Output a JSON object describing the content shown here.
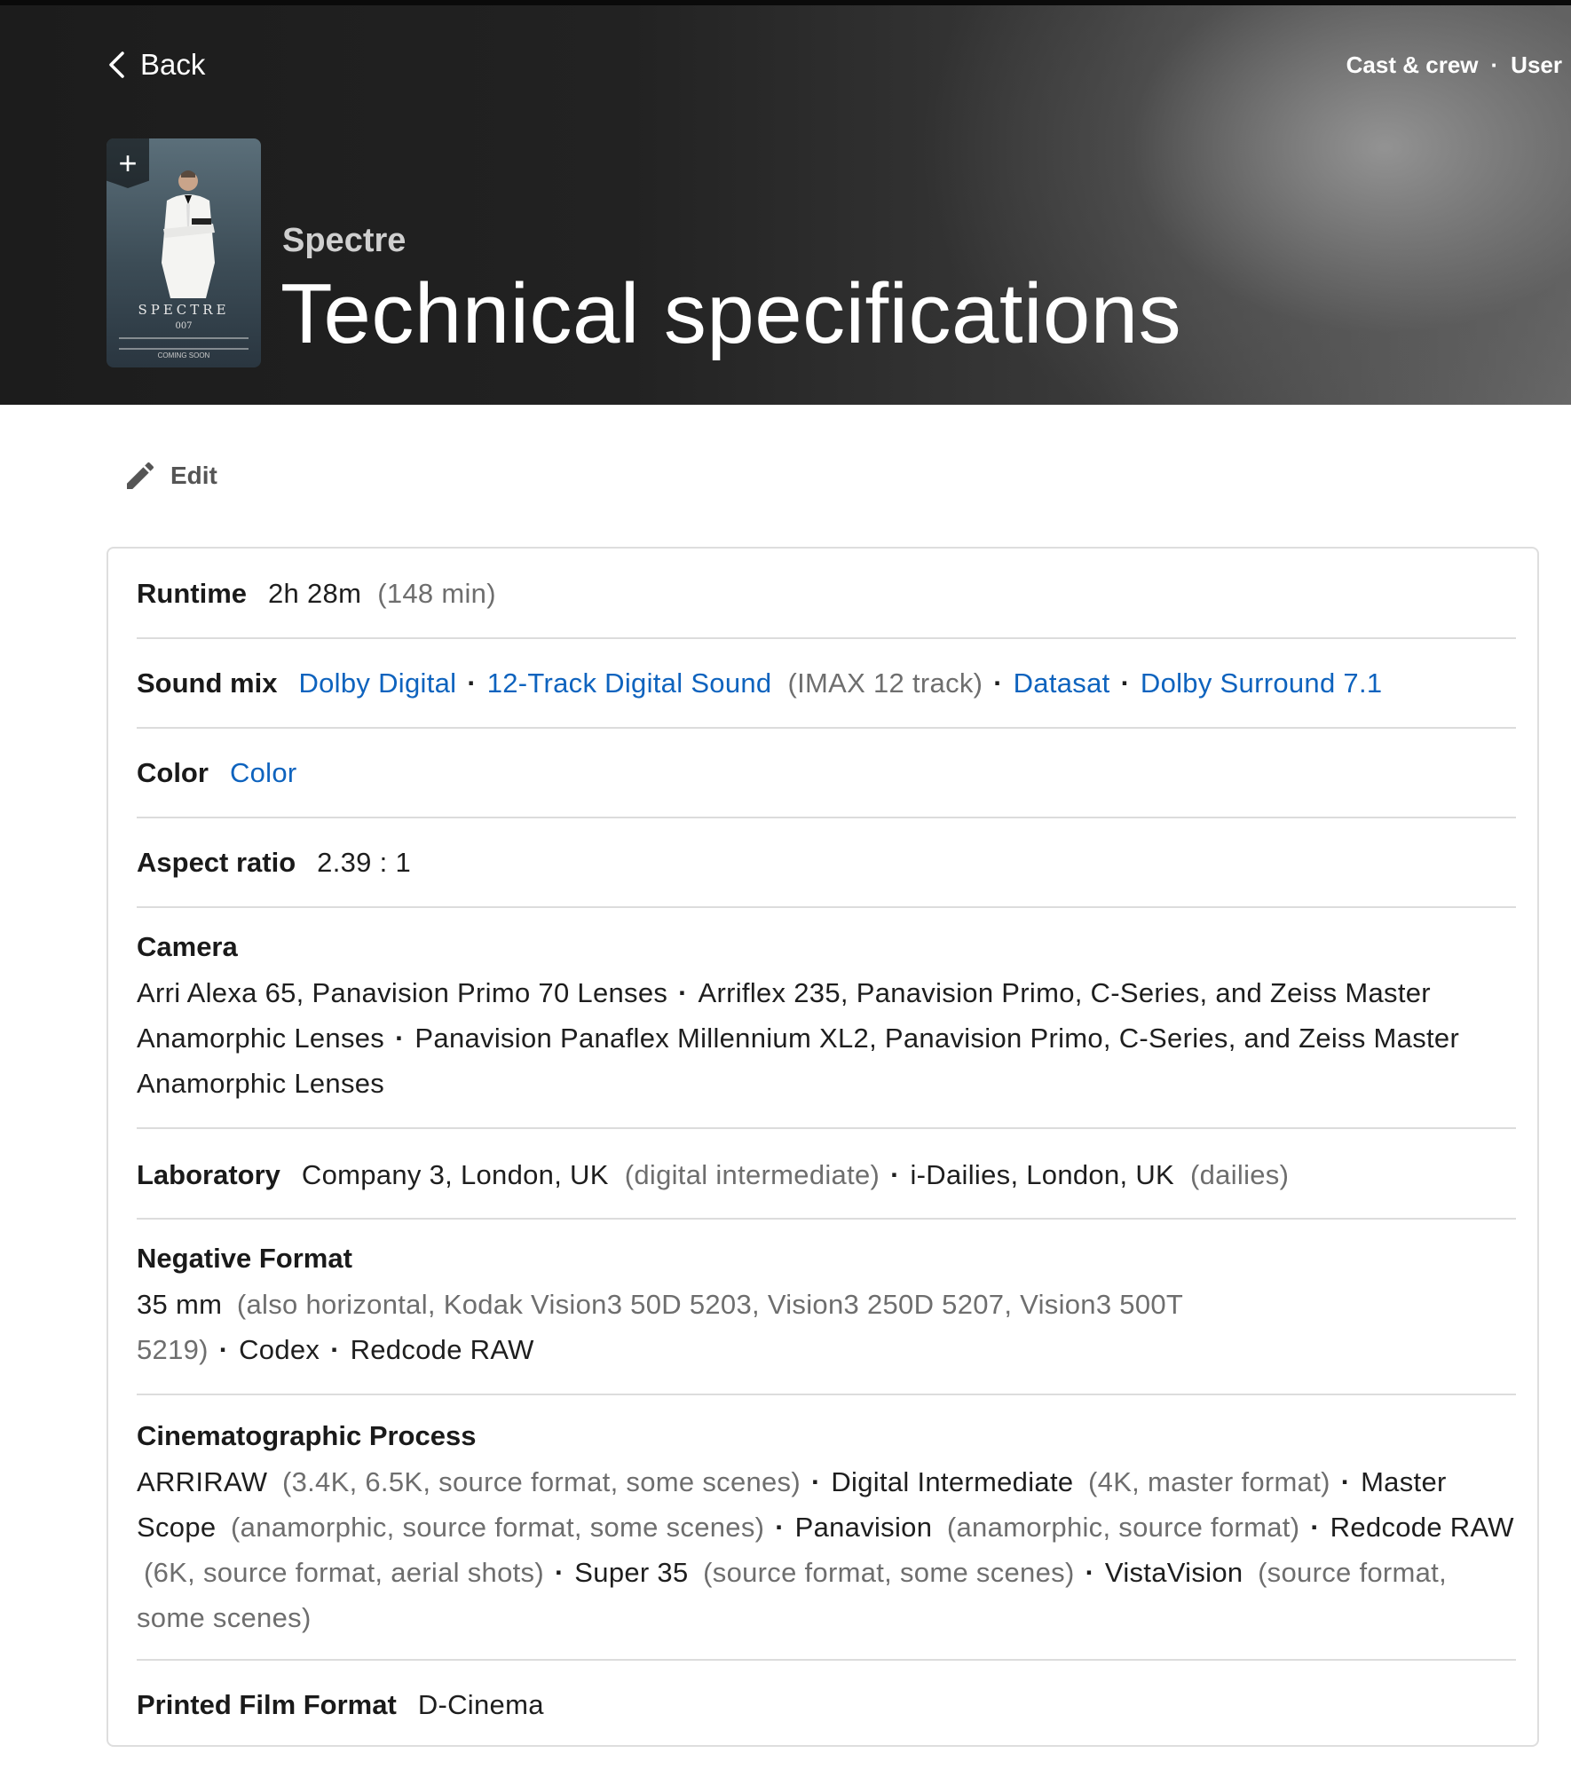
{
  "header": {
    "back_label": "Back",
    "nav": [
      "Cast & crew",
      "User"
    ],
    "nav_separator": "·",
    "movie_title": "Spectre",
    "page_title": "Technical specifications",
    "poster": {
      "title": "SPECTRE",
      "tagline": "007",
      "footer": "COMING SOON"
    }
  },
  "edit_label": "Edit",
  "specs": {
    "runtime": {
      "label": "Runtime",
      "value": "2h 28m",
      "note": "(148 min)"
    },
    "sound_mix": {
      "label": "Sound mix",
      "items": [
        {
          "text": "Dolby Digital",
          "link": true
        },
        {
          "text": "12-Track Digital Sound",
          "link": true,
          "note": "(IMAX 12 track)"
        },
        {
          "text": "Datasat",
          "link": true
        },
        {
          "text": "Dolby Surround 7.1",
          "link": true
        }
      ]
    },
    "color": {
      "label": "Color",
      "value": "Color"
    },
    "aspect_ratio": {
      "label": "Aspect ratio",
      "value": "2.39 : 1"
    },
    "camera": {
      "label": "Camera",
      "items": [
        "Arri Alexa 65, Panavision Primo 70 Lenses",
        "Arriflex 235, Panavision Primo, C-Series, and Zeiss Master Anamorphic Lenses",
        "Panavision Panaflex Millennium XL2, Panavision Primo, C-Series, and Zeiss Master Anamorphic Lenses"
      ]
    },
    "laboratory": {
      "label": "Laboratory",
      "items": [
        {
          "text": "Company 3, London, UK",
          "note": "(digital intermediate)"
        },
        {
          "text": "i-Dailies, London, UK",
          "note": "(dailies)"
        }
      ]
    },
    "negative_format": {
      "label": "Negative Format",
      "items": [
        {
          "text": "35 mm",
          "note": "(also horizontal, Kodak Vision3 50D 5203, Vision3 250D 5207, Vision3 500T 5219)"
        },
        {
          "text": "Codex"
        },
        {
          "text": "Redcode RAW"
        }
      ]
    },
    "cinematographic_process": {
      "label": "Cinematographic Process",
      "items": [
        {
          "text": "ARRIRAW",
          "note": "(3.4K, 6.5K, source format, some scenes)"
        },
        {
          "text": "Digital Intermediate",
          "note": "(4K, master format)"
        },
        {
          "text": "Master Scope",
          "note": "(anamorphic, source format, some scenes)"
        },
        {
          "text": "Panavision",
          "note": "(anamorphic, source format)"
        },
        {
          "text": "Redcode RAW",
          "note": "(6K, source format, aerial shots)"
        },
        {
          "text": "Super 35",
          "note": "(source format, some scenes)"
        },
        {
          "text": "VistaVision",
          "note": "(source format, some scenes)"
        }
      ]
    },
    "printed_film_format": {
      "label": "Printed Film Format",
      "value": "D-Cinema"
    }
  },
  "colors": {
    "link": "#0e63be",
    "note": "#6e6e6e",
    "text": "#1e1e1e"
  }
}
